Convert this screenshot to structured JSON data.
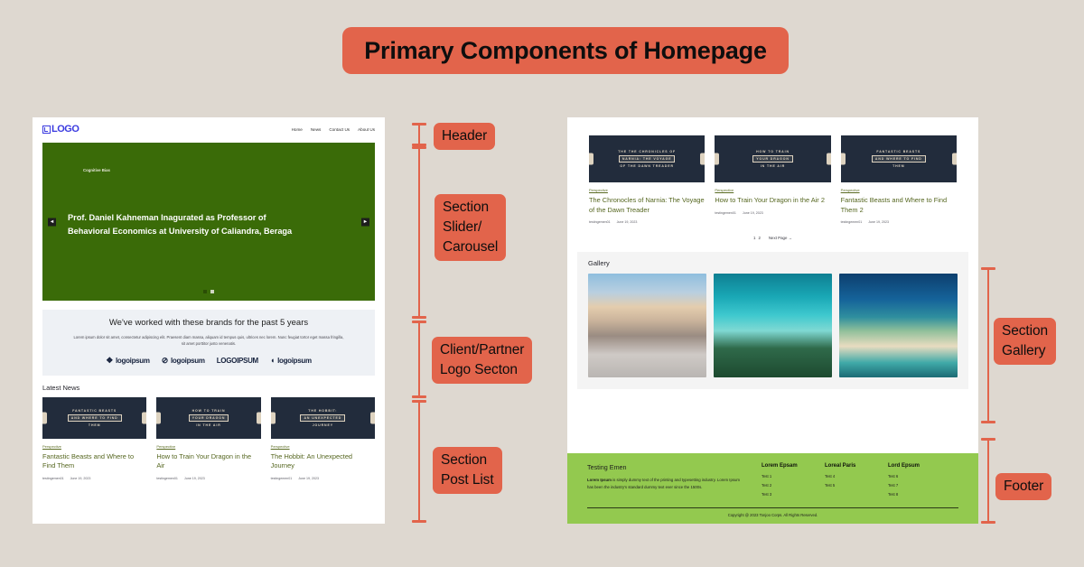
{
  "title": "Primary Components of Homepage",
  "annotations": [
    {
      "id": "header",
      "label": "Header"
    },
    {
      "id": "slider",
      "label": "Section\nSlider/\nCarousel"
    },
    {
      "id": "clients",
      "label": "Client/Partner\nLogo Secton"
    },
    {
      "id": "posts",
      "label": "Section\nPost List"
    },
    {
      "id": "gallery",
      "label": "Section\nGallery"
    },
    {
      "id": "footer",
      "label": "Footer"
    }
  ],
  "colors": {
    "background": "#ded8d0",
    "accent": "#e2644b",
    "slider_green": "#3a6b08",
    "footer_green": "#93c94f",
    "link_green": "#55661f",
    "logo_blue": "#3a3ae0"
  },
  "left_page": {
    "logo": "LOGO",
    "nav": [
      "Home",
      "News",
      "Contact Us",
      "About Us"
    ],
    "slider": {
      "kicker": "Cognitive Bias",
      "headline": "Prof. Daniel Kahneman Inagurated as Professor of Behavioral Economics at University of Caliandra, Beraga",
      "prev_arrow": "◀",
      "next_arrow": "▶",
      "dots": 2,
      "active_dot": 2
    },
    "clients": {
      "heading": "We've worked with these brands for the past 5 years",
      "body": "Lorem ipsum dolor sit amet, consectetur adipiscing elit. Praesent diam massa, aliquam id tempus quis, ultrices nec lorem. Nunc feugiat tortor eget massa fringilla, sit amet porttitor justo venenatis.",
      "brands": [
        "logoipsum",
        "logoipsum",
        "LOGOIPSUM",
        "logoipsum"
      ]
    },
    "posts_heading": "Latest News",
    "posts": [
      {
        "thumb_lines": [
          "FANTASTIC BEASTS",
          "AND WHERE TO FIND",
          "THEM"
        ],
        "category": "Perspective",
        "title": "Fantastic Beasts and Where to Find Them",
        "author": "testingemen01",
        "date": "June 19, 2023"
      },
      {
        "thumb_lines": [
          "HOW TO TRAIN",
          "YOUR DRAGON",
          "IN THE AIR"
        ],
        "category": "Perspective",
        "title": "How to Train Your Dragon in the Air",
        "author": "testingemen01",
        "date": "June 19, 2023"
      },
      {
        "thumb_lines": [
          "THE HOBBIT:",
          "AN UNEXPECTED",
          "JOURNEY"
        ],
        "category": "Perspective",
        "title": "The Hobbit: An Unexpected Journey",
        "author": "testingemen01",
        "date": "June 19, 2023"
      }
    ]
  },
  "right_page": {
    "posts": [
      {
        "thumb_lines": [
          "THE THE CHRONICLES OF",
          "NARNIA: THE VOYAGE",
          "OF THE DAWN TREADER"
        ],
        "category": "Perspective",
        "title": "The Chronocles of Narnia: The Voyage of the Dawn Treader",
        "author": "testingemen01",
        "date": "June 19, 2023"
      },
      {
        "thumb_lines": [
          "HOW TO TRAIN",
          "YOUR DRAGON",
          "IN THE AIR"
        ],
        "category": "Perspective",
        "title": "How to Train Your Dragon in the Air 2",
        "author": "testingemen01",
        "date": "June 19, 2023"
      },
      {
        "thumb_lines": [
          "FANTASTIC BEASTS",
          "AND WHERE TO FIND",
          "THEM"
        ],
        "category": "Perspective",
        "title": "Fantastic Beasts and Where to Find Them 2",
        "author": "testingemen01",
        "date": "June 19, 2023"
      }
    ],
    "pagination": {
      "page_1": "1",
      "page_2": "2",
      "next": "Next Page →"
    },
    "gallery": {
      "heading": "Gallery",
      "images": [
        "mount-bromo-volcano-photo",
        "aerial-turquoise-sea-forest-photo",
        "kelingking-cliff-beach-photo"
      ]
    },
    "footer": {
      "about_title": "Testing Emen",
      "about_lead": "Lorem Ipsum",
      "about_body": " is simply dummy text of the printing and typesetting industry. Lorem Ipsum has been the industry's standard dummy text ever since the 1500s.",
      "columns": [
        {
          "heading": "Lorem Epsam",
          "items": [
            "Test 1",
            "Test 2",
            "Test 3"
          ]
        },
        {
          "heading": "Loreal Paris",
          "items": [
            "Test 4",
            "Test 5"
          ]
        },
        {
          "heading": "Lord Epsum",
          "items": [
            "Test 6",
            "Test 7",
            "Test 8"
          ]
        }
      ],
      "copyright": "Copyright @ 2023 Tonjoo Corps. All Rights Reserved."
    }
  }
}
